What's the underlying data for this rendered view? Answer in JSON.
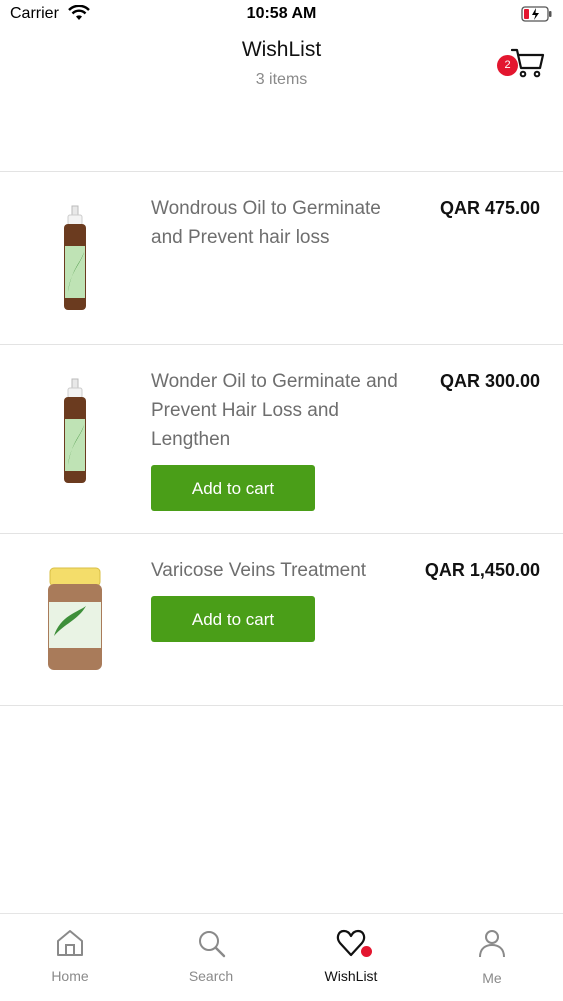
{
  "status_bar": {
    "carrier": "Carrier",
    "time": "10:58 AM"
  },
  "header": {
    "title": "WishList",
    "subtitle": "3 items",
    "cart_count": "2"
  },
  "items": [
    {
      "name": "Wondrous Oil to Germinate and Prevent hair loss",
      "price": "QAR 475.00",
      "image": "spray-bottle-oil",
      "add_to_cart": null
    },
    {
      "name": "Wonder Oil to Germinate and Prevent Hair Loss and Lengthen",
      "price": "QAR 300.00",
      "image": "spray-bottle-oil",
      "add_to_cart": "Add to cart"
    },
    {
      "name": "Varicose Veins Treatment",
      "price": "QAR 1,450.00",
      "image": "herbal-jar",
      "add_to_cart": "Add to cart"
    }
  ],
  "tabbar": {
    "tabs": [
      {
        "label": "Home",
        "icon": "home-icon"
      },
      {
        "label": "Search",
        "icon": "search-icon"
      },
      {
        "label": "WishList",
        "icon": "heart-icon",
        "active": true
      },
      {
        "label": "Me",
        "icon": "person-icon"
      }
    ]
  },
  "colors": {
    "accent": "#4a9e18",
    "badge": "#e3162f"
  }
}
